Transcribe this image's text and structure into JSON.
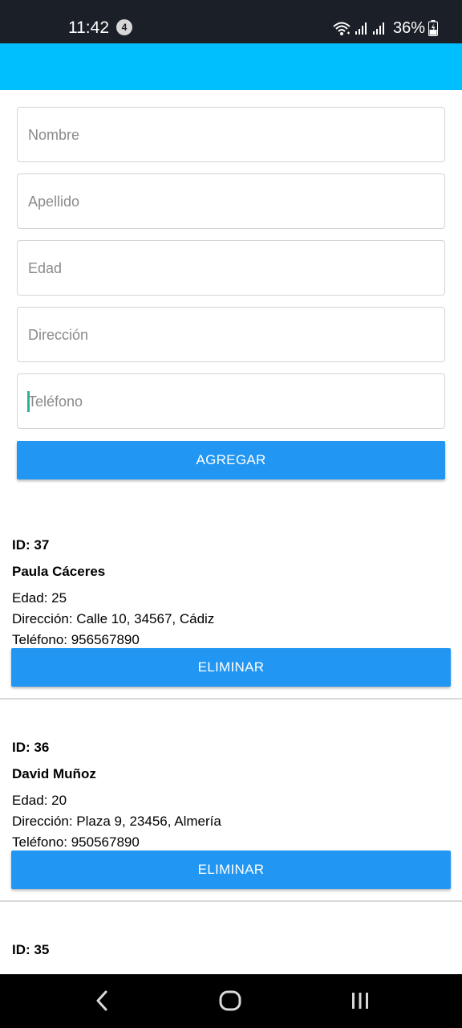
{
  "status_bar": {
    "time": "11:42",
    "notification_count": "4",
    "battery": "36%",
    "icons": [
      "wifi-icon",
      "signal-icon",
      "signal-icon",
      "battery-icon"
    ]
  },
  "app_bar": {
    "color": "#00bfff"
  },
  "form": {
    "nombre_placeholder": "Nombre",
    "apellido_placeholder": "Apellido",
    "edad_placeholder": "Edad",
    "direccion_placeholder": "Dirección",
    "telefono_placeholder": "Teléfono",
    "add_button": "AGREGAR",
    "button_color": "#2196f3"
  },
  "people": [
    {
      "id": "ID: 37",
      "name": "Paula Cáceres",
      "edad": "Edad: 25",
      "direccion": "Dirección: Calle 10, 34567, Cádiz",
      "telefono": "Teléfono: 956567890",
      "delete_label": "ELIMINAR"
    },
    {
      "id": "ID: 36",
      "name": "David Muñoz",
      "edad": "Edad: 20",
      "direccion": "Dirección: Plaza 9, 23456, Almería",
      "telefono": "Teléfono: 950567890",
      "delete_label": "ELIMINAR"
    },
    {
      "id": "ID: 35"
    }
  ],
  "nav_bar": {
    "icons": [
      "back-icon",
      "home-icon",
      "recents-icon"
    ]
  }
}
